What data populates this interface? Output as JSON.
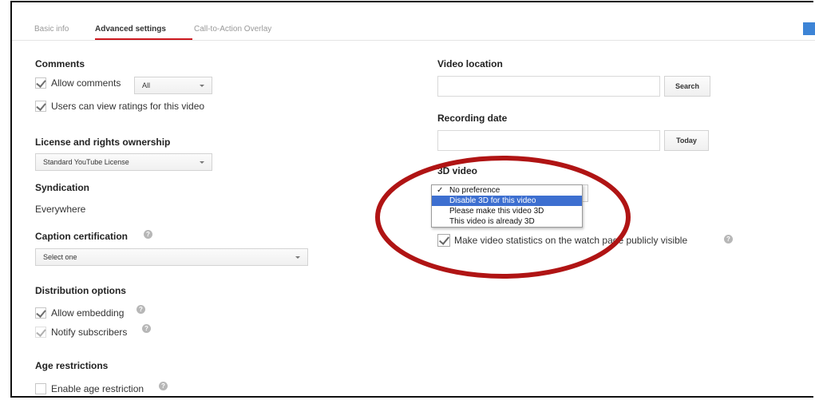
{
  "tabs": [
    {
      "label": "Basic info"
    },
    {
      "label": "Advanced settings"
    },
    {
      "label": "Call-to-Action Overlay"
    }
  ],
  "comments": {
    "heading": "Comments",
    "allow_comments": "Allow comments",
    "allow_comments_select": "All",
    "view_ratings": "Users can view ratings for this video"
  },
  "license": {
    "heading": "License and rights ownership",
    "select": "Standard YouTube License"
  },
  "syndication": {
    "heading": "Syndication",
    "value": "Everywhere"
  },
  "caption": {
    "heading": "Caption certification",
    "select": "Select one"
  },
  "distribution": {
    "heading": "Distribution options",
    "allow_embedding": "Allow embedding",
    "notify_subscribers": "Notify subscribers"
  },
  "age": {
    "heading": "Age restrictions",
    "enable": "Enable age restriction"
  },
  "video_location": {
    "heading": "Video location",
    "search_button": "Search"
  },
  "recording_date": {
    "heading": "Recording date",
    "today_button": "Today"
  },
  "video_3d": {
    "heading": "3D video",
    "checkmark": "✓",
    "options": [
      "No preference",
      "Disable 3D for this video",
      "Please make this video 3D",
      "This video is already 3D"
    ],
    "selected_index": 0,
    "highlighted_index": 1
  },
  "statistics": {
    "label": "Make video statistics on the watch page publicly visible"
  },
  "help_glyph": "?",
  "colors": {
    "active_tab_underline": "#cc181e",
    "dropdown_highlight": "#3d6fd0",
    "annotation_oval": "#b01414"
  }
}
